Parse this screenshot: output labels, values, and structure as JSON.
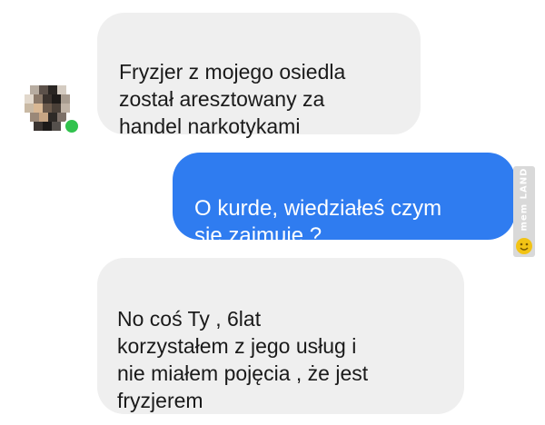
{
  "conversation": {
    "messages": [
      {
        "direction": "incoming",
        "text": "Fryzjer z mojego osiedla\nzostał aresztowany za\nhandel narkotykami"
      },
      {
        "direction": "outgoing",
        "text": "O kurde, wiedziałeś czym\nsię zajmuje ?"
      },
      {
        "direction": "incoming",
        "text": "No coś Ty , 6lat\nkorzystałem z jego usług i\nnie miałem pojęcia , że jest\nfryzjerem"
      }
    ]
  },
  "contact": {
    "status": "online",
    "avatar_icon": "pixelated-avatar-icon"
  },
  "watermark": {
    "text": "mem LAND"
  },
  "colors": {
    "incoming_bubble": "#efefef",
    "outgoing_bubble": "#2f7cf0",
    "online_indicator": "#31c24d",
    "watermark_background": "#d9d9d9",
    "watermark_icon": "#f2c315"
  }
}
